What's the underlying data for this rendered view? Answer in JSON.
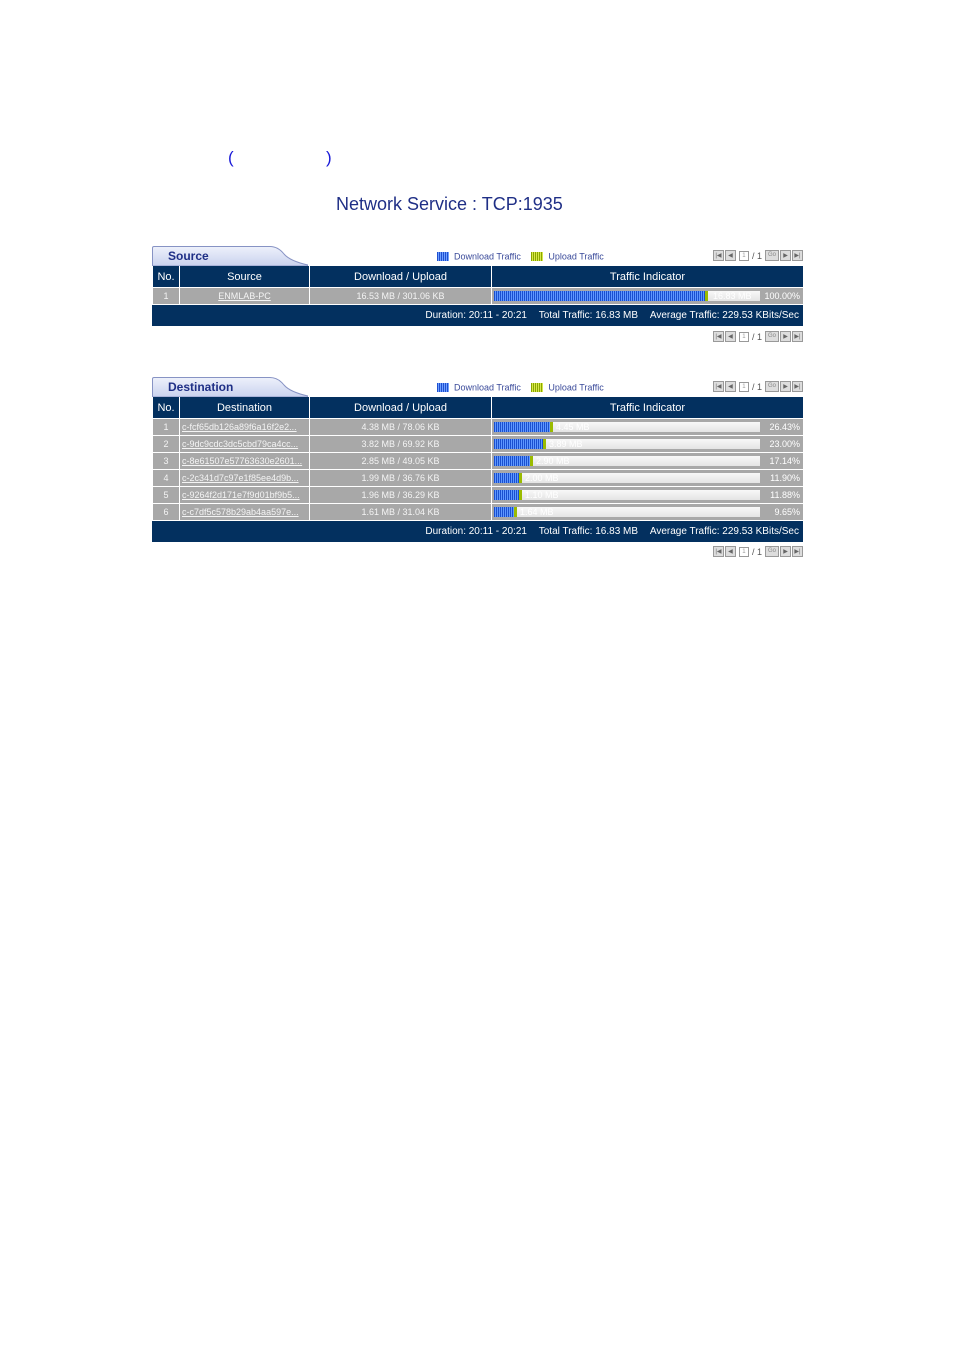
{
  "header": {
    "paren_left": "(",
    "paren_right": ")",
    "title": "Network Service : TCP:1935"
  },
  "legend": {
    "download": "Download Traffic",
    "upload": "Upload Traffic"
  },
  "colors": {
    "header_bg": "#03305f",
    "row_bg": "#a8a8a8",
    "download": "#1a4fcf",
    "upload": "#9bbb00",
    "title": "#1f2f86"
  },
  "pager": {
    "first_icon": "first-page-icon",
    "prev_icon": "prev-page-icon",
    "page_value": "1",
    "total": "/ 1",
    "go_label": "Go",
    "next_icon": "next-page-icon",
    "last_icon": "last-page-icon"
  },
  "source": {
    "tab_label": "Source",
    "columns": [
      "No.",
      "Source",
      "Download / Upload",
      "Traffic Indicator"
    ],
    "rows": [
      {
        "no": "1",
        "name": "ENMLAB-PC",
        "dlul": "16.53 MB / 301.06 KB",
        "bar_label": "16.83 MB",
        "pct": "100.00%",
        "fraction": 1.0
      }
    ],
    "summary": {
      "duration": "Duration: 20:11 - 20:21",
      "total": "Total Traffic: 16.83 MB",
      "average": "Average Traffic: 229.53 KBits/Sec"
    }
  },
  "destination": {
    "tab_label": "Destination",
    "columns": [
      "No.",
      "Destination",
      "Download / Upload",
      "Traffic Indicator"
    ],
    "rows": [
      {
        "no": "1",
        "name": "c-fcf65db126a89f6a16f2e2...",
        "dlul": "4.38 MB / 78.06 KB",
        "bar_label": "4.45 MB",
        "pct": "26.43%",
        "fraction": 0.2643
      },
      {
        "no": "2",
        "name": "c-9dc9cdc3dc5cbd79ca4cc...",
        "dlul": "3.82 MB / 69.92 KB",
        "bar_label": "3.89 MB",
        "pct": "23.00%",
        "fraction": 0.23
      },
      {
        "no": "3",
        "name": "c-8e61507e57763630e2601...",
        "dlul": "2.85 MB / 49.05 KB",
        "bar_label": "2.90 MB",
        "pct": "17.14%",
        "fraction": 0.1714
      },
      {
        "no": "4",
        "name": "c-2c341d7c97e1f85ee4d9b...",
        "dlul": "1.99 MB / 36.76 KB",
        "bar_label": "2.00 MB",
        "pct": "11.90%",
        "fraction": 0.119
      },
      {
        "no": "5",
        "name": "c-9264f2d171e7f9d01bf9b5...",
        "dlul": "1.96 MB / 36.29 KB",
        "bar_label": "1.10 MB",
        "pct": "11.88%",
        "fraction": 0.1188
      },
      {
        "no": "6",
        "name": "c-c7df5c578b29ab4aa597e...",
        "dlul": "1.61 MB / 31.04 KB",
        "bar_label": "1.64 MB",
        "pct": "9.65%",
        "fraction": 0.0965
      }
    ],
    "summary": {
      "duration": "Duration: 20:11 - 20:21",
      "total": "Total Traffic: 16.83 MB",
      "average": "Average Traffic: 229.53 KBits/Sec"
    }
  }
}
